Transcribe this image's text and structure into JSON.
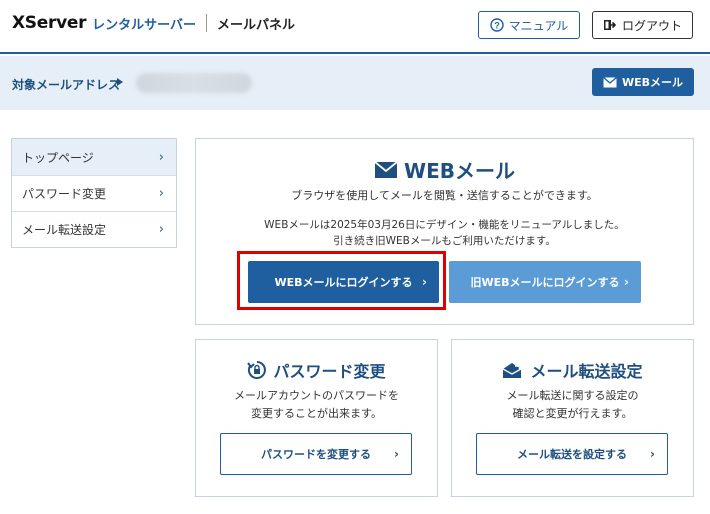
{
  "header": {
    "logo_brand": "XServer",
    "logo_service": "レンタルサーバー",
    "panel_name": "メールパネル",
    "manual_label": "マニュアル",
    "logout_label": "ログアウト"
  },
  "address_bar": {
    "label": "対象メールアドレス",
    "webmail_label": "WEBメール"
  },
  "sidebar": {
    "items": [
      {
        "label": "トップページ"
      },
      {
        "label": "パスワード変更"
      },
      {
        "label": "メール転送設定"
      }
    ]
  },
  "webmail_card": {
    "title": "WEBメール",
    "description": "ブラウザを使用してメールを閲覧・送信することができます。",
    "notice_line1": "WEBメールは2025年03月26日にデザイン・機能をリニューアルしました。",
    "notice_line2": "引き続き旧WEBメールもご利用いただけます。",
    "login_label": "WEBメールにログインする",
    "old_login_label": "旧WEBメールにログインする"
  },
  "password_card": {
    "title": "パスワード変更",
    "desc_line1": "メールアカウントのパスワードを",
    "desc_line2": "変更することが出来ます。",
    "button_label": "パスワードを変更する"
  },
  "forward_card": {
    "title": "メール転送設定",
    "desc_line1": "メール転送に関する設定の",
    "desc_line2": "確認と変更が行えます。",
    "button_label": "メール転送を設定する"
  },
  "colors": {
    "primary": "#1f5fa0",
    "secondary": "#5b9bd6",
    "highlight": "#e00000",
    "band": "#e6eef7"
  }
}
